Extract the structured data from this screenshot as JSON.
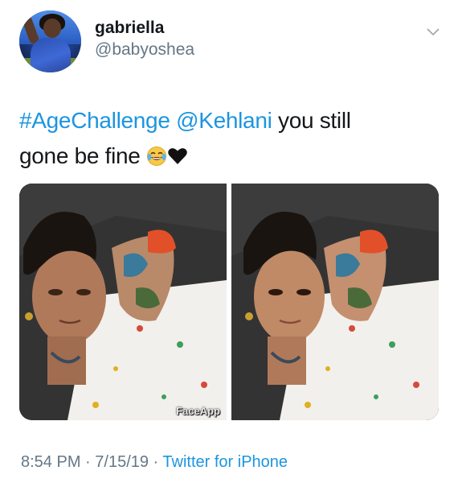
{
  "tweet": {
    "display_name": "gabriella",
    "handle": "@babyoshea",
    "text": {
      "hashtag": "#AgeChallenge",
      "mention": "@Kehlani",
      "line1_rest": " you still",
      "line2": "gone be fine "
    },
    "emoji": [
      "face-with-tears-of-joy",
      "black-heart"
    ],
    "media": {
      "watermark": "FaceApp"
    },
    "footer": {
      "time": "8:54 PM",
      "date": "7/15/19",
      "separator": " · ",
      "source": "Twitter for iPhone"
    }
  },
  "colors": {
    "text": "#14171a",
    "secondary": "#657786",
    "link": "#1b95e0"
  }
}
